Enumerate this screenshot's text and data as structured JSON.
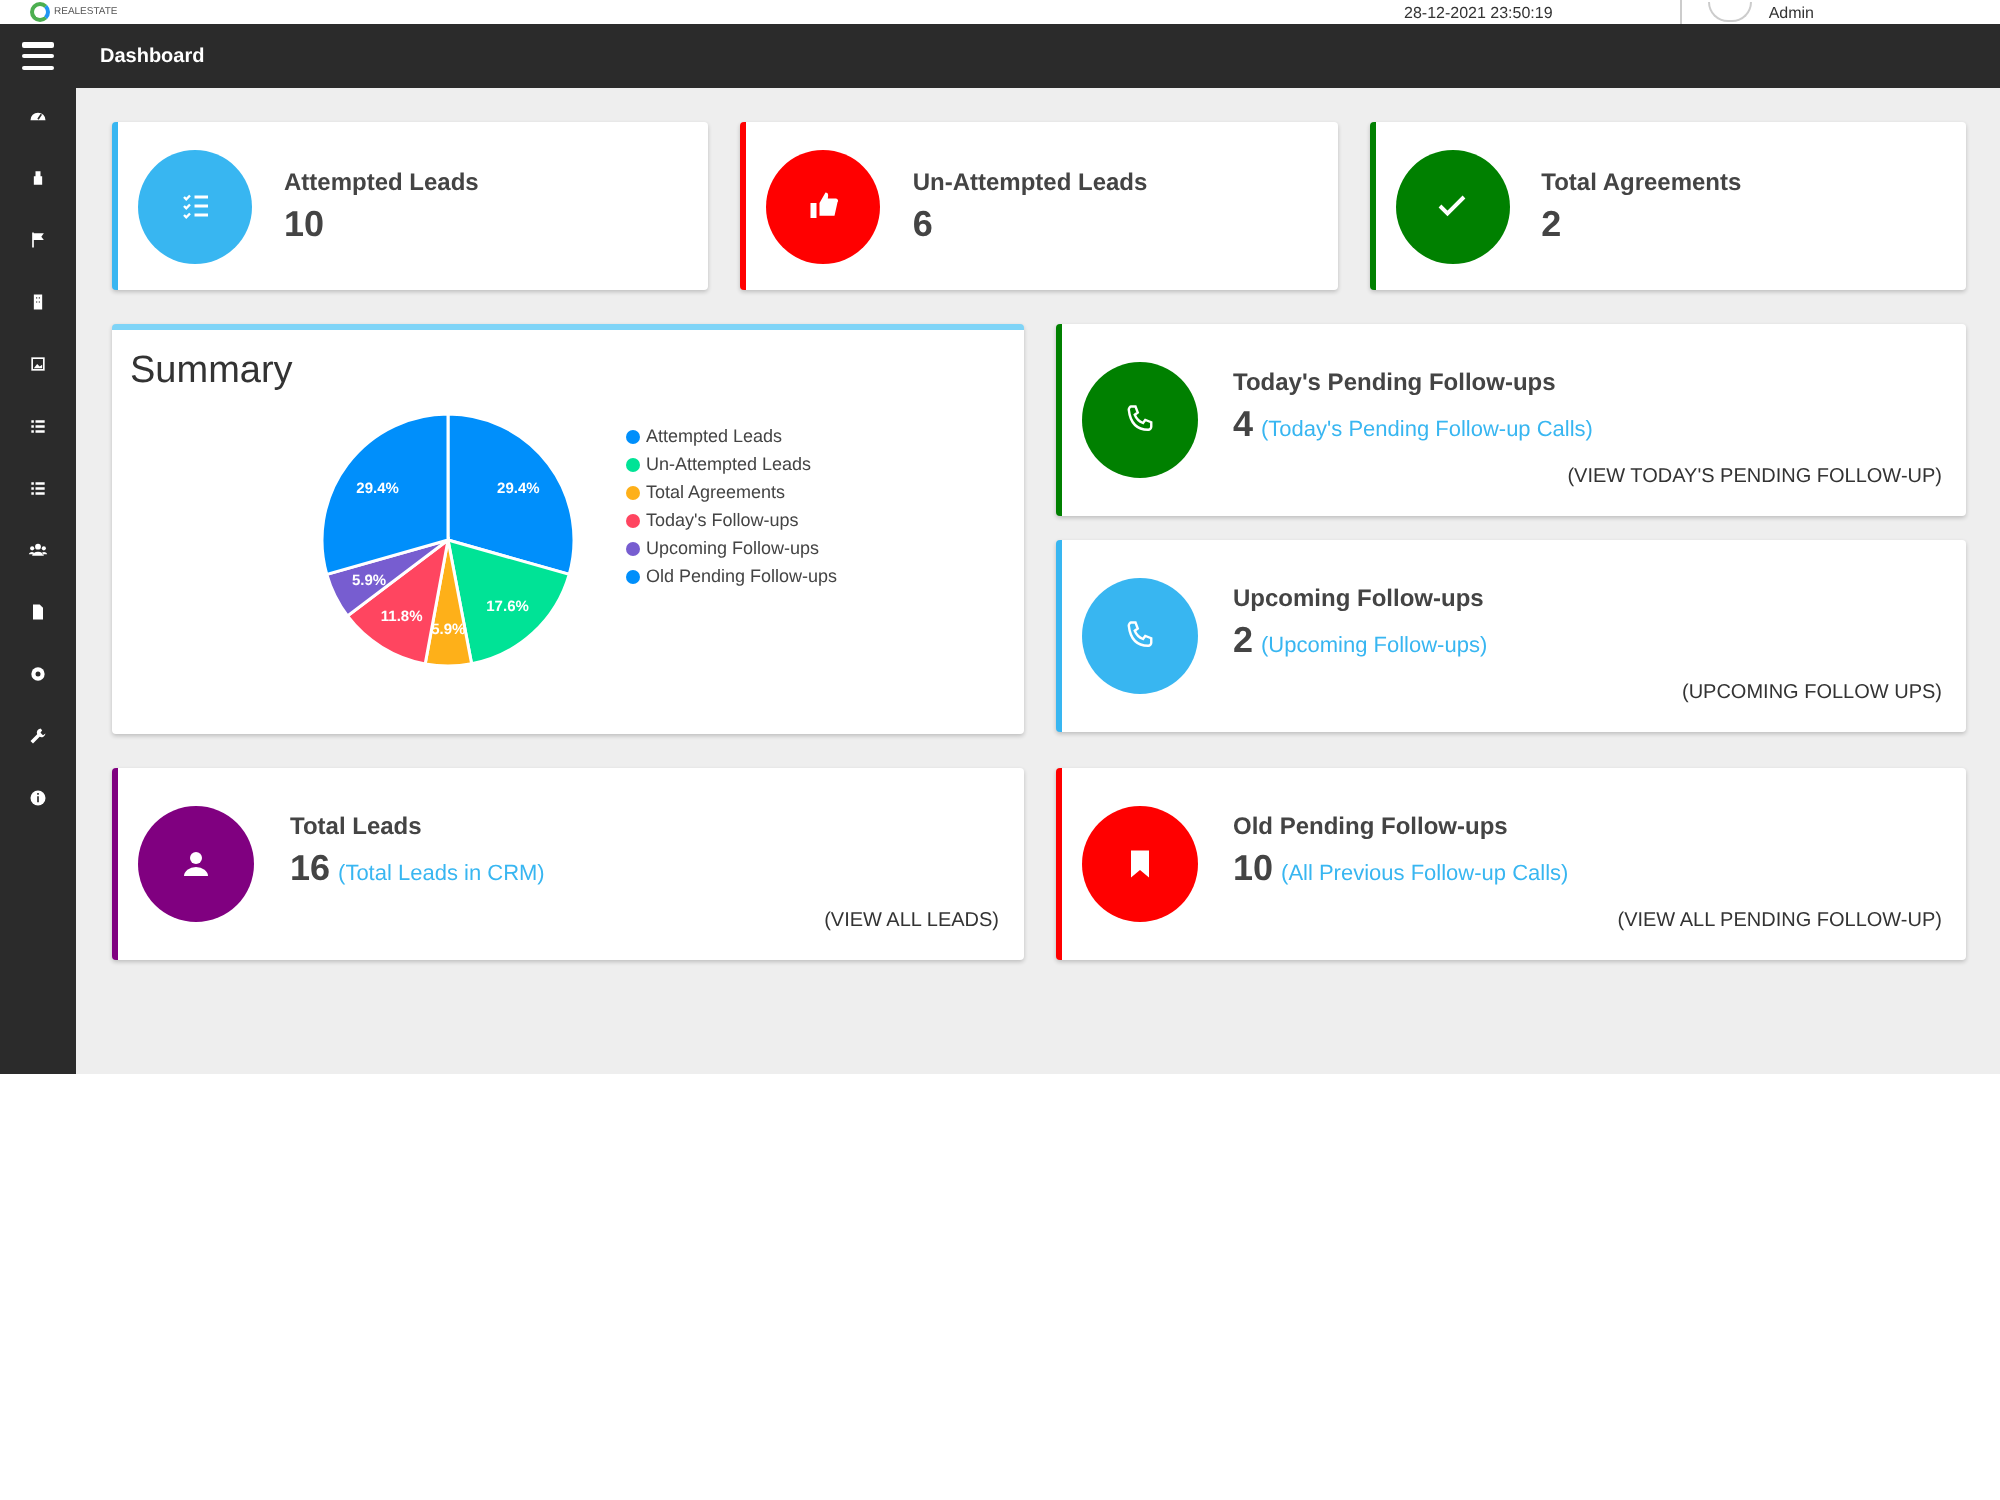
{
  "header": {
    "logo_text": "REALESTATE",
    "datetime": "28-12-2021 23:50:19",
    "user": "Admin"
  },
  "topbar": {
    "title": "Dashboard"
  },
  "top_cards": [
    {
      "title": "Attempted Leads",
      "count": "10",
      "color": "#38b6f1"
    },
    {
      "title": "Un-Attempted Leads",
      "count": "6",
      "color": "#ff0000"
    },
    {
      "title": "Total Agreements",
      "count": "2",
      "color": "#008000"
    }
  ],
  "summary": {
    "title": "Summary",
    "chart_data": {
      "type": "pie",
      "categories": [
        "Attempted Leads",
        "Un-Attempted Leads",
        "Total Agreements",
        "Today's Follow-ups",
        "Upcoming Follow-ups",
        "Old Pending Follow-ups"
      ],
      "colors": [
        "#008ffb",
        "#00e396",
        "#feb019",
        "#ff4560",
        "#775dd0",
        "#008ffb"
      ],
      "series": [
        {
          "values": [
            29.4,
            17.6,
            5.9,
            11.8,
            5.9,
            29.4
          ]
        }
      ],
      "value_labels": [
        "29.4%",
        "17.6%",
        "5.9%",
        "11.8%",
        "5.9%",
        "29.4%"
      ],
      "legend": "right"
    }
  },
  "follow_cards": [
    {
      "title": "Today's Pending Follow-ups",
      "count": "4",
      "link": "(Today's Pending Follow-up Calls)",
      "action": "(VIEW TODAY'S PENDING FOLLOW-UP)",
      "color": "#008000"
    },
    {
      "title": "Upcoming Follow-ups",
      "count": "2",
      "link": "(Upcoming Follow-ups)",
      "action": "(UPCOMING FOLLOW UPS)",
      "color": "#38b6f1"
    }
  ],
  "bottom_cards": [
    {
      "title": "Total Leads",
      "count": "16",
      "link": "(Total Leads in CRM)",
      "action": "(VIEW ALL LEADS)",
      "color": "#800080"
    },
    {
      "title": "Old Pending Follow-ups",
      "count": "10",
      "link": "(All Previous Follow-up Calls)",
      "action": "(VIEW ALL PENDING FOLLOW-UP)",
      "color": "#ff0000"
    }
  ]
}
